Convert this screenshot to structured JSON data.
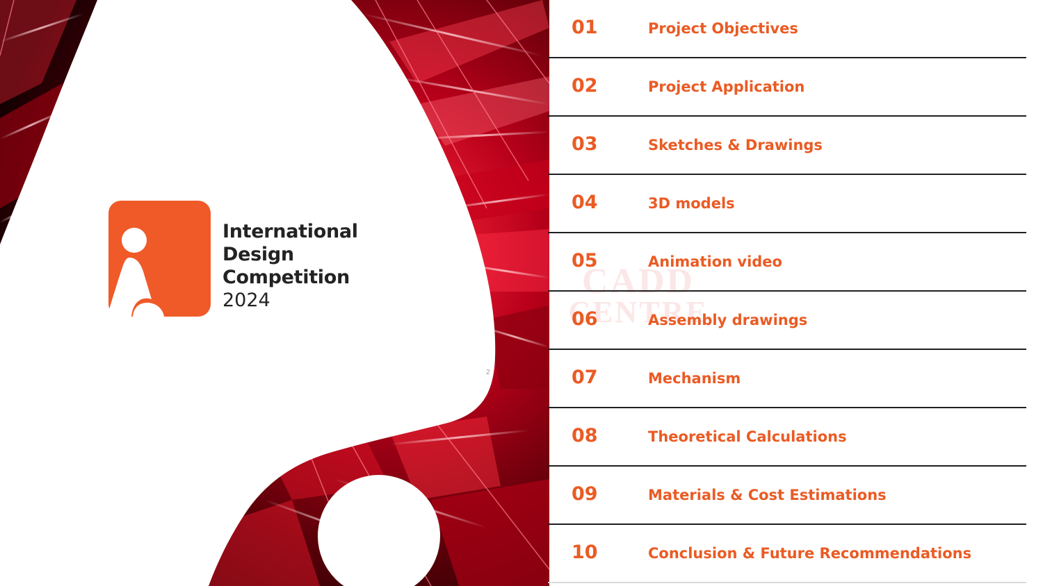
{
  "slide": {
    "page_number": "2"
  },
  "logo": {
    "icon": "person-silhouette-logo-icon",
    "brand_color": "#ef5a28",
    "line1": "International",
    "line2": "Design",
    "line3": "Competition",
    "year": "2024"
  },
  "watermark": {
    "line1": "CADD",
    "line2": "CENTRE"
  },
  "colors": {
    "accent": "#ea5b24",
    "divider": "#1f1f1f",
    "art_red": "#d8001a"
  },
  "toc": {
    "items": [
      {
        "num": "01",
        "title": "Project Objectives"
      },
      {
        "num": "02",
        "title": "Project Application"
      },
      {
        "num": "03",
        "title": "Sketches & Drawings"
      },
      {
        "num": "04",
        "title": "3D models"
      },
      {
        "num": "05",
        "title": "Animation video"
      },
      {
        "num": "06",
        "title": "Assembly drawings"
      },
      {
        "num": "07",
        "title": "Mechanism"
      },
      {
        "num": "08",
        "title": "Theoretical Calculations"
      },
      {
        "num": "09",
        "title": "Materials & Cost Estimations"
      },
      {
        "num": "10",
        "title": "Conclusion & Future Recommendations"
      }
    ]
  }
}
